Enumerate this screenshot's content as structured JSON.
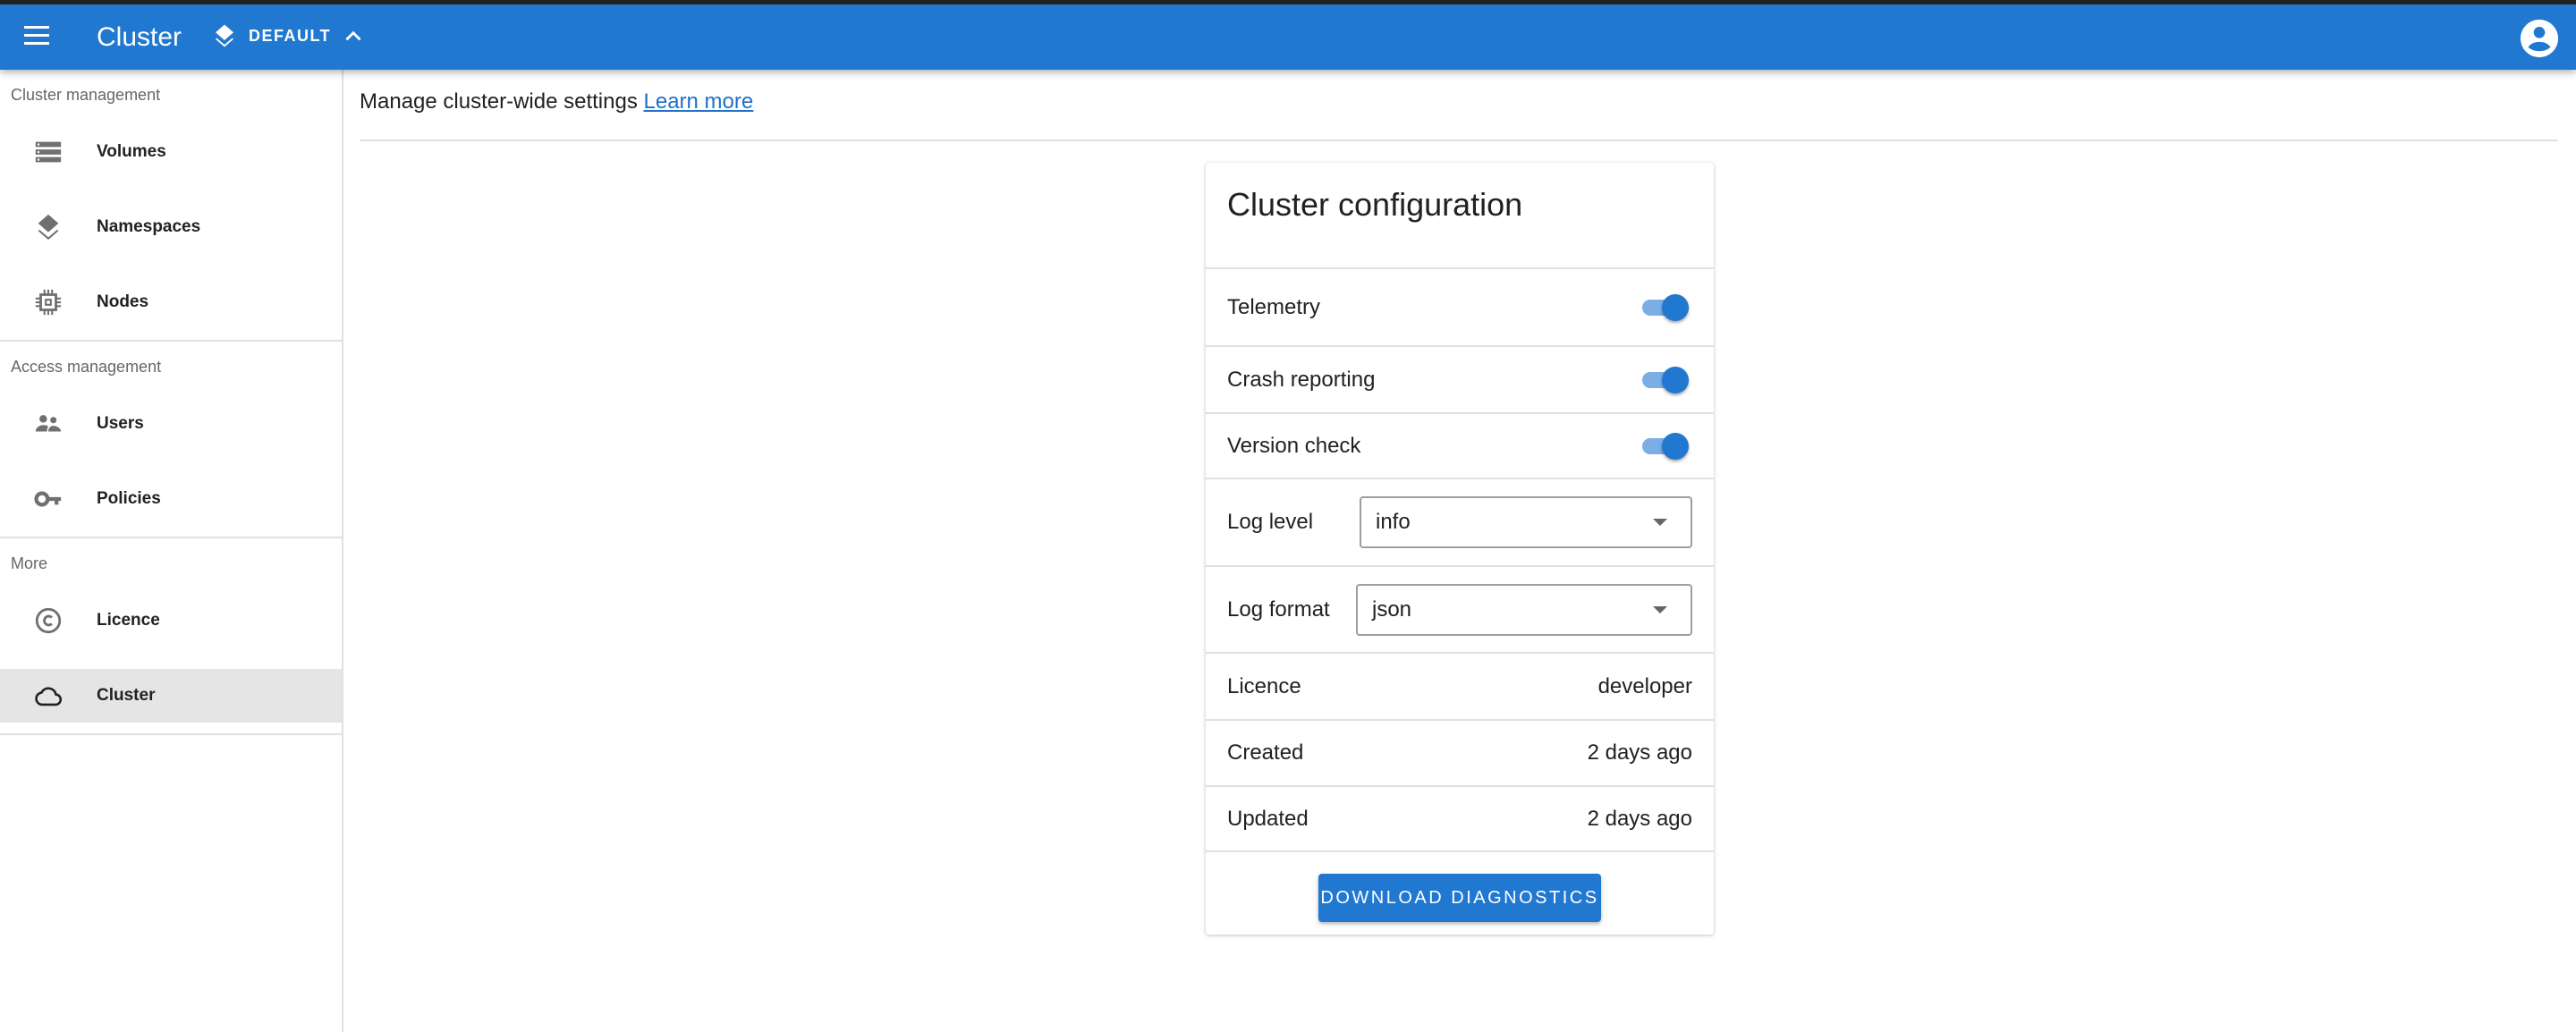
{
  "header": {
    "title": "Cluster",
    "namespace": "DEFAULT"
  },
  "sidebar": {
    "sections": [
      {
        "label": "Cluster management",
        "items": [
          {
            "label": "Volumes"
          },
          {
            "label": "Namespaces"
          },
          {
            "label": "Nodes"
          }
        ]
      },
      {
        "label": "Access management",
        "items": [
          {
            "label": "Users"
          },
          {
            "label": "Policies"
          }
        ]
      },
      {
        "label": "More",
        "items": [
          {
            "label": "Licence"
          },
          {
            "label": "Cluster",
            "selected": true
          }
        ]
      }
    ]
  },
  "main": {
    "intro": "Manage cluster-wide settings",
    "learn_more": "Learn more"
  },
  "card": {
    "title": "Cluster configuration",
    "toggles": [
      {
        "label": "Telemetry",
        "on": true
      },
      {
        "label": "Crash reporting",
        "on": true
      },
      {
        "label": "Version check",
        "on": true
      }
    ],
    "log_level": {
      "label": "Log level",
      "value": "info"
    },
    "log_format": {
      "label": "Log format",
      "value": "json"
    },
    "info": [
      {
        "label": "Licence",
        "value": "developer"
      },
      {
        "label": "Created",
        "value": "2 days ago"
      },
      {
        "label": "Updated",
        "value": "2 days ago"
      }
    ],
    "button": "DOWNLOAD DIAGNOSTICS"
  },
  "colors": {
    "primary": "#2178d0",
    "link": "#1e70c8"
  }
}
